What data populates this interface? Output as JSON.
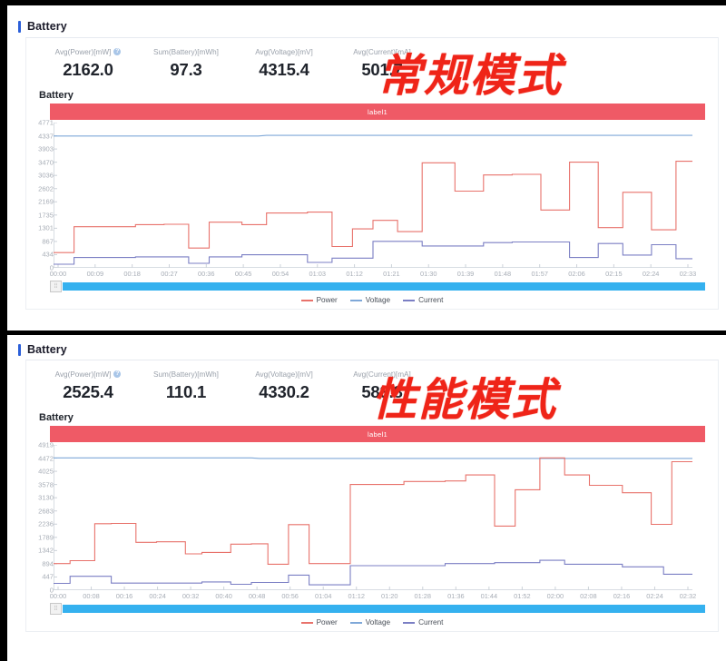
{
  "panels": [
    {
      "header": "Battery",
      "overlay_text": "常规模式",
      "overlay_color": "#ef2418",
      "stats": [
        {
          "label": "Avg(Power)[mW]",
          "value": "2162.0",
          "has_help_icon": true
        },
        {
          "label": "Sum(Battery)[mWh]",
          "value": "97.3",
          "has_help_icon": false
        },
        {
          "label": "Avg(Voltage)[mV]",
          "value": "4315.4",
          "has_help_icon": false
        },
        {
          "label": "Avg(Current)[mA]",
          "value": "501.7",
          "has_help_icon": false
        }
      ],
      "chart_caption": "Battery",
      "label_bar": "label1",
      "scroll_handle_icon": "grip-icon",
      "legend": [
        {
          "name": "Power",
          "color": "#e8726b"
        },
        {
          "name": "Voltage",
          "color": "#7fa8d8"
        },
        {
          "name": "Current",
          "color": "#7b7fc4"
        }
      ]
    },
    {
      "header": "Battery",
      "overlay_text": "性能模式",
      "overlay_color": "#ef2418",
      "stats": [
        {
          "label": "Avg(Power)[mW]",
          "value": "2525.4",
          "has_help_icon": true
        },
        {
          "label": "Sum(Battery)[mWh]",
          "value": "110.1",
          "has_help_icon": false
        },
        {
          "label": "Avg(Voltage)[mV]",
          "value": "4330.2",
          "has_help_icon": false
        },
        {
          "label": "Avg(Current)[mA]",
          "value": "583.8",
          "has_help_icon": false
        }
      ],
      "chart_caption": "Battery",
      "label_bar": "label1",
      "scroll_handle_icon": "grip-icon",
      "legend": [
        {
          "name": "Power",
          "color": "#e8726b"
        },
        {
          "name": "Voltage",
          "color": "#7fa8d8"
        },
        {
          "name": "Current",
          "color": "#7b7fc4"
        }
      ]
    }
  ],
  "chart_data": [
    {
      "type": "line",
      "title": "Battery",
      "subtitle": "label1",
      "xlabel": "",
      "ylabel": "",
      "grid": false,
      "legend_position": "bottom",
      "ylim": [
        0,
        4771
      ],
      "yticks": [
        0,
        434,
        867,
        1301,
        1735,
        2169,
        2602,
        3036,
        3470,
        3903,
        4337,
        4771
      ],
      "xticks": [
        "00:00",
        "00:09",
        "00:18",
        "00:27",
        "00:36",
        "00:45",
        "00:54",
        "01:03",
        "01:12",
        "01:21",
        "01:30",
        "01:39",
        "01:48",
        "01:57",
        "02:06",
        "02:15",
        "02:24",
        "02:33"
      ],
      "x_minutes_range": [
        0,
        156
      ],
      "series": [
        {
          "name": "Voltage",
          "color": "#7fa8d8",
          "units": "mV",
          "x": [
            0,
            50,
            52,
            156
          ],
          "values": [
            4330,
            4330,
            4350,
            4350
          ]
        },
        {
          "name": "Power",
          "color": "#e8726b",
          "units": "mW",
          "x": [
            0,
            5,
            5,
            20,
            20,
            27,
            27,
            33,
            33,
            38,
            38,
            46,
            46,
            52,
            52,
            62,
            62,
            68,
            68,
            73,
            73,
            78,
            78,
            84,
            84,
            90,
            90,
            98,
            98,
            105,
            105,
            112,
            112,
            119,
            119,
            126,
            126,
            133,
            133,
            139,
            139,
            146,
            146,
            152,
            152,
            156
          ],
          "values": [
            500,
            500,
            1350,
            1350,
            1420,
            1420,
            1430,
            1430,
            650,
            650,
            1500,
            1500,
            1420,
            1420,
            1800,
            1800,
            1830,
            1830,
            700,
            700,
            1280,
            1280,
            1560,
            1560,
            1190,
            1190,
            3450,
            3450,
            2520,
            2520,
            3050,
            3050,
            3070,
            3070,
            1900,
            1900,
            3470,
            3470,
            1320,
            1320,
            2480,
            2480,
            1250,
            1250,
            3500,
            3500
          ]
        },
        {
          "name": "Current",
          "color": "#7b7fc4",
          "units": "mA",
          "x": [
            0,
            5,
            5,
            20,
            20,
            33,
            33,
            38,
            38,
            46,
            46,
            62,
            62,
            68,
            68,
            78,
            78,
            90,
            90,
            105,
            105,
            112,
            112,
            126,
            126,
            133,
            133,
            139,
            139,
            146,
            146,
            152,
            152,
            156
          ],
          "values": [
            120,
            120,
            340,
            340,
            360,
            360,
            150,
            150,
            360,
            360,
            430,
            430,
            180,
            180,
            320,
            320,
            870,
            870,
            720,
            720,
            830,
            830,
            850,
            850,
            340,
            340,
            800,
            800,
            420,
            420,
            760,
            760,
            300,
            300
          ]
        }
      ]
    },
    {
      "type": "line",
      "title": "Battery",
      "subtitle": "label1",
      "xlabel": "",
      "ylabel": "",
      "grid": false,
      "legend_position": "bottom",
      "ylim": [
        0,
        4919
      ],
      "yticks": [
        0,
        447,
        894,
        1342,
        1789,
        2236,
        2683,
        3130,
        3578,
        4025,
        4472,
        4919
      ],
      "xticks": [
        "00:00",
        "00:08",
        "00:16",
        "00:24",
        "00:32",
        "00:40",
        "00:48",
        "00:56",
        "01:04",
        "01:12",
        "01:20",
        "01:28",
        "01:36",
        "01:44",
        "01:52",
        "02:00",
        "02:08",
        "02:16",
        "02:24",
        "02:32"
      ],
      "x_minutes_range": [
        0,
        155
      ],
      "series": [
        {
          "name": "Voltage",
          "color": "#7fa8d8",
          "units": "mV",
          "x": [
            0,
            48,
            50,
            155
          ],
          "values": [
            4480,
            4480,
            4460,
            4460
          ]
        },
        {
          "name": "Power",
          "color": "#e8726b",
          "units": "mW",
          "x": [
            0,
            4,
            4,
            10,
            10,
            14,
            14,
            20,
            20,
            25,
            25,
            32,
            32,
            36,
            36,
            43,
            43,
            48,
            48,
            52,
            52,
            57,
            57,
            62,
            62,
            72,
            72,
            85,
            85,
            95,
            95,
            100,
            100,
            107,
            107,
            112,
            112,
            118,
            118,
            124,
            124,
            130,
            130,
            138,
            138,
            145,
            145,
            150,
            150,
            155
          ],
          "values": [
            900,
            900,
            1000,
            1000,
            2250,
            2250,
            2260,
            2260,
            1620,
            1620,
            1640,
            1640,
            1230,
            1230,
            1280,
            1280,
            1560,
            1560,
            1570,
            1570,
            880,
            880,
            2220,
            2220,
            900,
            900,
            3580,
            3580,
            3680,
            3680,
            3700,
            3700,
            3900,
            3900,
            2170,
            2170,
            3400,
            3400,
            4480,
            4480,
            3900,
            3900,
            3550,
            3550,
            3300,
            3300,
            2230,
            2230,
            4350,
            4350
          ]
        },
        {
          "name": "Current",
          "color": "#7b7fc4",
          "units": "mA",
          "x": [
            0,
            4,
            4,
            14,
            14,
            36,
            36,
            43,
            43,
            48,
            48,
            57,
            57,
            62,
            62,
            72,
            72,
            95,
            95,
            107,
            107,
            118,
            118,
            124,
            124,
            138,
            138,
            148,
            148,
            155
          ],
          "values": [
            230,
            230,
            470,
            470,
            240,
            240,
            280,
            280,
            200,
            200,
            260,
            260,
            510,
            510,
            180,
            180,
            830,
            830,
            900,
            900,
            930,
            930,
            1010,
            1010,
            880,
            880,
            790,
            790,
            540,
            540
          ]
        }
      ]
    }
  ]
}
